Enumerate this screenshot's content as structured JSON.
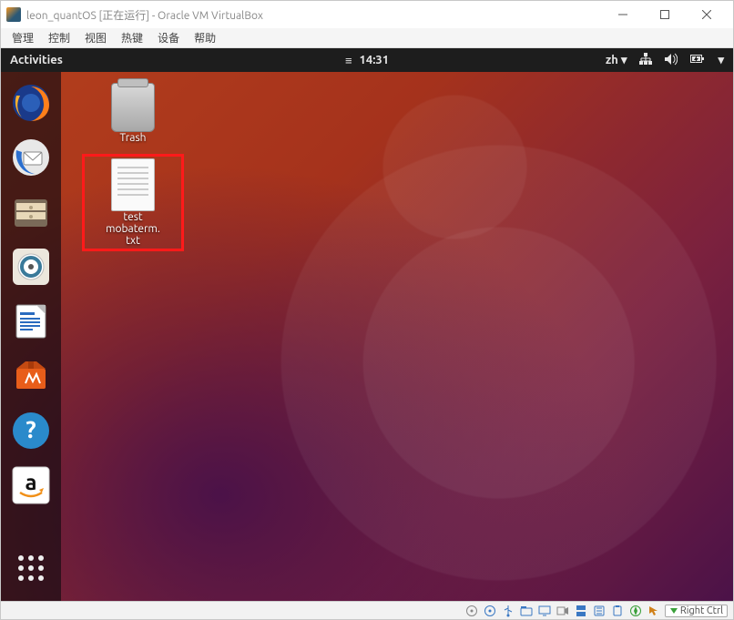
{
  "host_window": {
    "title": "leon_quantOS [正在运行] - Oracle VM VirtualBox",
    "menu": [
      "管理",
      "控制",
      "视图",
      "热键",
      "设备",
      "帮助"
    ],
    "status_host_key": "Right Ctrl"
  },
  "gnome": {
    "activities_label": "Activities",
    "time_icon": "≡",
    "time": "14:31",
    "lang": "zh",
    "lang_caret": "▾",
    "sys_caret": "▾"
  },
  "dock": {
    "items": [
      {
        "name": "firefox"
      },
      {
        "name": "thunderbird"
      },
      {
        "name": "files"
      },
      {
        "name": "rhythmbox"
      },
      {
        "name": "libreoffice-writer"
      },
      {
        "name": "software"
      },
      {
        "name": "help"
      },
      {
        "name": "amazon"
      }
    ]
  },
  "desktop_icons": [
    {
      "label": "Trash",
      "kind": "trash",
      "highlight": false
    },
    {
      "label": "test\nmobaterm.\ntxt",
      "kind": "file",
      "highlight": true
    }
  ]
}
